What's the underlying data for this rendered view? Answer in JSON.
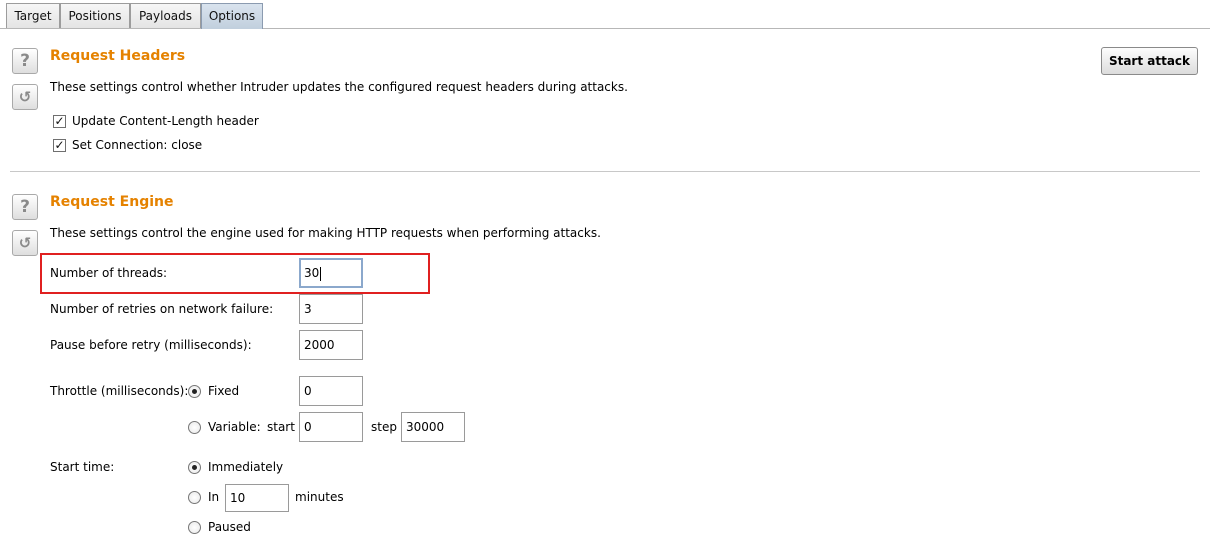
{
  "tabs": [
    {
      "label": "Target"
    },
    {
      "label": "Positions"
    },
    {
      "label": "Payloads"
    },
    {
      "label": "Options"
    }
  ],
  "icons": {
    "help": "?",
    "reset": "↺"
  },
  "start_attack_label": "Start attack",
  "request_headers": {
    "title": "Request Headers",
    "description": "These settings control whether Intruder updates the configured request headers during attacks.",
    "options": [
      {
        "label": "Update Content-Length header",
        "checked": true
      },
      {
        "label": "Set Connection: close",
        "checked": true
      }
    ]
  },
  "request_engine": {
    "title": "Request Engine",
    "description": "These settings control the engine used for making HTTP requests when performing attacks.",
    "threads_label": "Number of threads:",
    "threads_value": "30",
    "retries_label": "Number of retries on network failure:",
    "retries_value": "3",
    "pause_label": "Pause before retry (milliseconds):",
    "pause_value": "2000",
    "throttle_label": "Throttle (milliseconds):",
    "throttle_fixed_label": "Fixed",
    "throttle_fixed_value": "0",
    "throttle_variable_label": "Variable:",
    "start_label": "start",
    "variable_start_value": "0",
    "step_label": "step",
    "variable_step_value": "30000",
    "start_time_label": "Start time:",
    "immediately_label": "Immediately",
    "in_label": "In",
    "in_value": "10",
    "minutes_label": "minutes",
    "paused_label": "Paused"
  }
}
